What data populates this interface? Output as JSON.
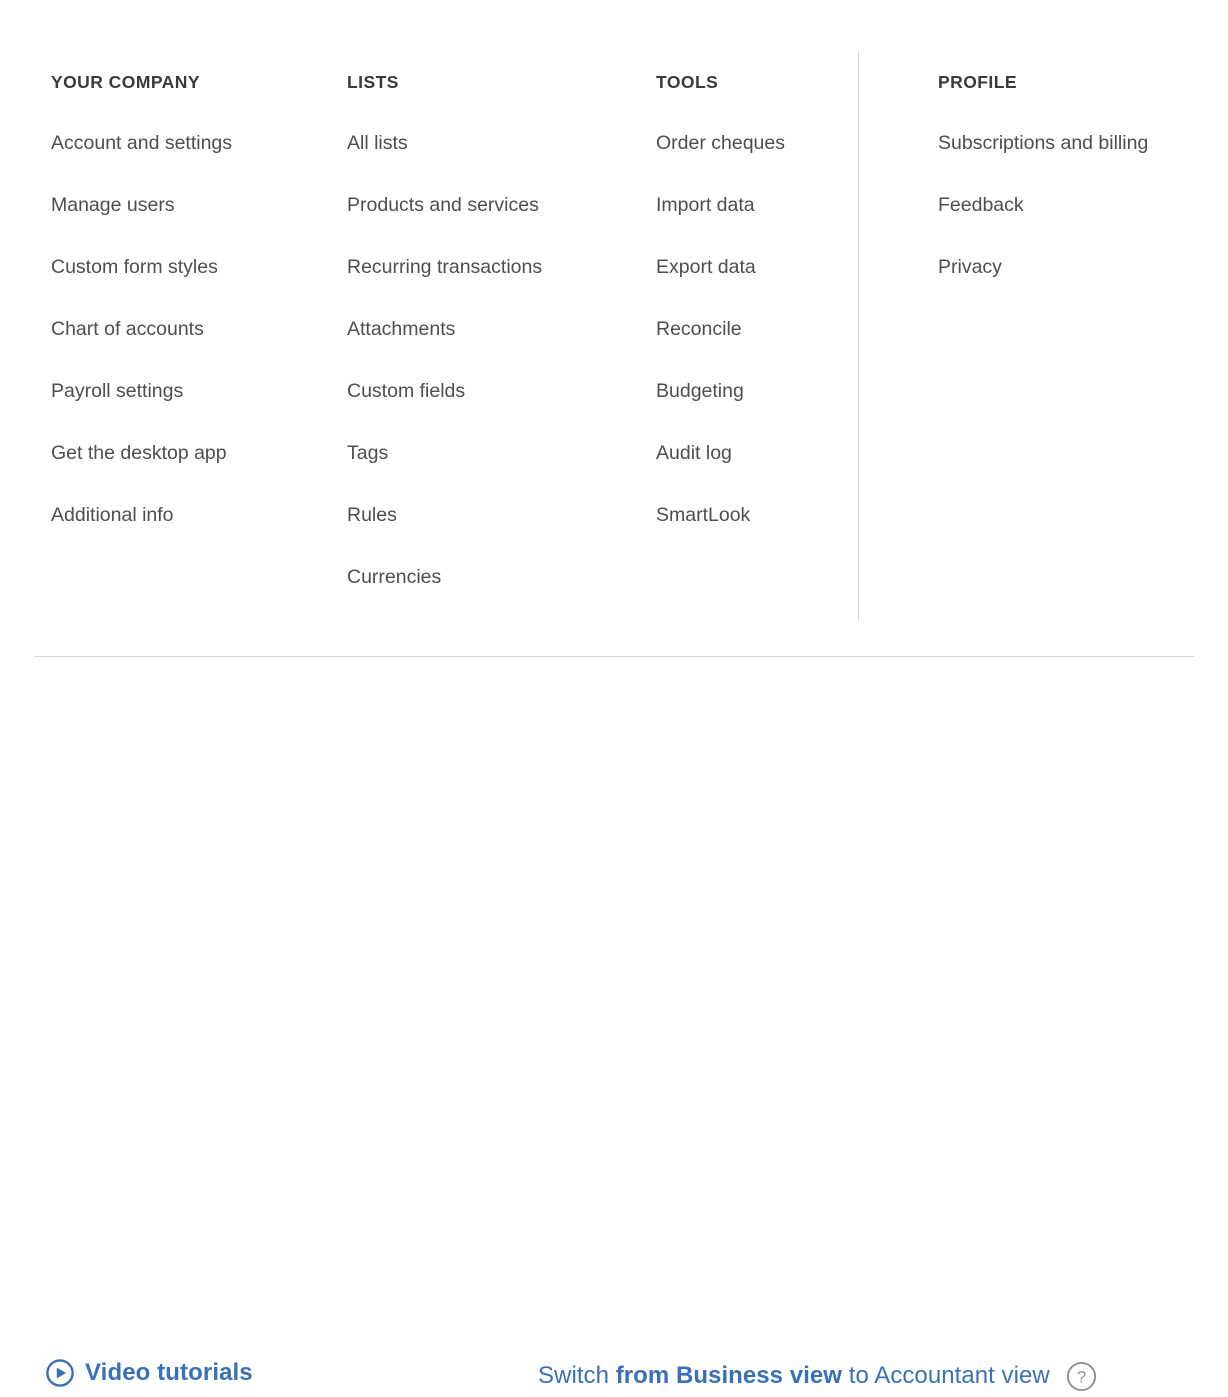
{
  "menu": {
    "columns": [
      {
        "heading": "YOUR COMPANY",
        "items": [
          "Account and settings",
          "Manage users",
          "Custom form styles",
          "Chart of accounts",
          "Payroll settings",
          "Get the desktop app",
          "Additional info"
        ]
      },
      {
        "heading": "LISTS",
        "items": [
          "All lists",
          "Products and services",
          "Recurring transactions",
          "Attachments",
          "Custom fields",
          "Tags",
          "Rules",
          "Currencies"
        ]
      },
      {
        "heading": "TOOLS",
        "items": [
          "Order cheques",
          "Import data",
          "Export data",
          "Reconcile",
          "Budgeting",
          "Audit log",
          "SmartLook"
        ]
      },
      {
        "heading": "PROFILE",
        "items": [
          "Subscriptions and billing",
          "Feedback",
          "Privacy"
        ]
      }
    ]
  },
  "footer": {
    "video_tutorials": {
      "label": "Video tutorials",
      "icon": "play-circle-icon"
    },
    "switch_view": {
      "prefix": "Switch ",
      "strong": "from Business view",
      "suffix": " to Accountant view",
      "help_icon": "question-mark-circle-icon"
    }
  },
  "colors": {
    "link_blue": "#3971b7",
    "heading_text": "#393a3d",
    "item_text": "#4e4e4e",
    "divider": "#d4d7dc",
    "help_icon_gray": "#8d8d8d",
    "background": "#ffffff"
  }
}
